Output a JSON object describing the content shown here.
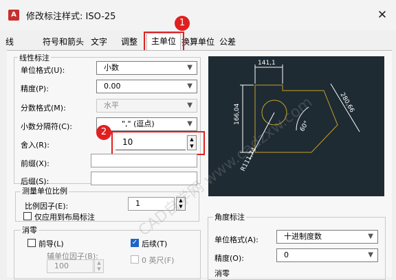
{
  "window": {
    "title": "修改标注样式: ISO-25",
    "app_icon_text": "A",
    "close_glyph": "✕"
  },
  "tabs": [
    "线",
    "符号和箭头",
    "文字",
    "调整",
    "主单位",
    "换算单位",
    "公差"
  ],
  "annotations": {
    "badge1": "1",
    "badge2": "2"
  },
  "linear": {
    "group_label": "线性标注",
    "unit_format": {
      "label": "单位格式(U):",
      "value": "小数"
    },
    "precision": {
      "label": "精度(P):",
      "value": "0.00"
    },
    "fraction_format": {
      "label": "分数格式(M):",
      "value": "水平"
    },
    "decimal_separator": {
      "label": "小数分隔符(C):",
      "value": "\",\" (逗点)"
    },
    "round_off": {
      "label": "舍入(R):",
      "value": "10"
    },
    "prefix": {
      "label": "前缀(X):",
      "value": ""
    },
    "suffix": {
      "label": "后缀(S):",
      "value": ""
    }
  },
  "measurement_scale": {
    "group_label": "测量单位比例",
    "scale_factor": {
      "label": "比例因子(E):",
      "value": "1"
    },
    "layout_only": {
      "label": "仅应用到布局标注",
      "checked": false
    }
  },
  "zero_suppression": {
    "group_label": "消零",
    "leading": {
      "label": "前导(L)",
      "checked": false
    },
    "sub_unit_factor": {
      "label": "辅单位因子(B):",
      "value": "100"
    },
    "trailing": {
      "label": "后续(T)",
      "checked": true
    },
    "feet": {
      "label": "0 英尺(F)",
      "checked": false
    }
  },
  "angular": {
    "group_label": "角度标注",
    "unit_format": {
      "label": "单位格式(A):",
      "value": "十进制度数"
    },
    "precision": {
      "label": "精度(O):",
      "value": "0"
    },
    "zero_label": "消零"
  },
  "preview": {
    "dim_top": "141,1",
    "dim_left": "166,04",
    "dim_right": "280,66",
    "dim_radius": "R111,74",
    "dim_angle": "60°"
  },
  "watermark": "CAD自学网 www.cadzxw.com",
  "colors": {
    "highlight": "#e02020",
    "preview_bg": "#1e2b33",
    "preview_geometry": "#c9a227",
    "check_blue": "#1e64c8"
  }
}
